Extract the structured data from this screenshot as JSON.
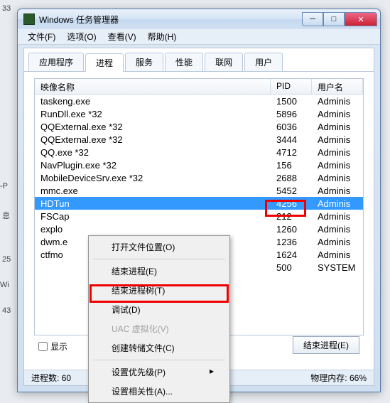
{
  "window": {
    "title": "Windows 任务管理器"
  },
  "menu": {
    "file": "文件(F)",
    "options": "选项(O)",
    "view": "查看(V)",
    "help": "帮助(H)"
  },
  "tabs": {
    "apps": "应用程序",
    "processes": "进程",
    "services": "服务",
    "performance": "性能",
    "network": "联网",
    "users": "用户"
  },
  "columns": {
    "image": "映像名称",
    "pid": "PID",
    "user": "用户名"
  },
  "rows": [
    {
      "name": "taskeng.exe",
      "pid": "1500",
      "user": "Adminis"
    },
    {
      "name": "RunDll.exe *32",
      "pid": "5896",
      "user": "Adminis"
    },
    {
      "name": "QQExternal.exe *32",
      "pid": "6036",
      "user": "Adminis"
    },
    {
      "name": "QQExternal.exe *32",
      "pid": "3444",
      "user": "Adminis"
    },
    {
      "name": "QQ.exe *32",
      "pid": "4712",
      "user": "Adminis"
    },
    {
      "name": "NavPlugin.exe *32",
      "pid": "156",
      "user": "Adminis"
    },
    {
      "name": "MobileDeviceSrv.exe *32",
      "pid": "2688",
      "user": "Adminis"
    },
    {
      "name": "mmc.exe",
      "pid": "5452",
      "user": "Adminis"
    },
    {
      "name": "HDTun",
      "pid": "4256",
      "user": "Adminis",
      "sel": true
    },
    {
      "name": "FSCap",
      "pid": "212",
      "user": "Adminis"
    },
    {
      "name": "explo",
      "pid": "1260",
      "user": "Adminis"
    },
    {
      "name": "dwm.e",
      "pid": "1236",
      "user": "Adminis"
    },
    {
      "name": "ctfmo",
      "pid": "1624",
      "user": "Adminis"
    },
    {
      "name": "",
      "pid": "500",
      "user": "SYSTEM"
    }
  ],
  "context": {
    "open_location": "打开文件位置(O)",
    "end_process": "结束进程(E)",
    "end_tree": "结束进程树(T)",
    "debug": "调试(D)",
    "uac": "UAC 虚拟化(V)",
    "dump": "创建转储文件(C)",
    "priority": "设置优先级(P)",
    "affinity": "设置相关性(A)..."
  },
  "footer": {
    "show_all": "显示",
    "end_btn": "结束进程(E)"
  },
  "status": {
    "procs_label": "进程数:",
    "procs_val": "60",
    "mem_label": "物理内存:",
    "mem_val": "66%"
  },
  "bg": {
    "a": "33",
    "b": "-P",
    "c": "息",
    "d": "25",
    "e": "Wi",
    "f": "43"
  }
}
